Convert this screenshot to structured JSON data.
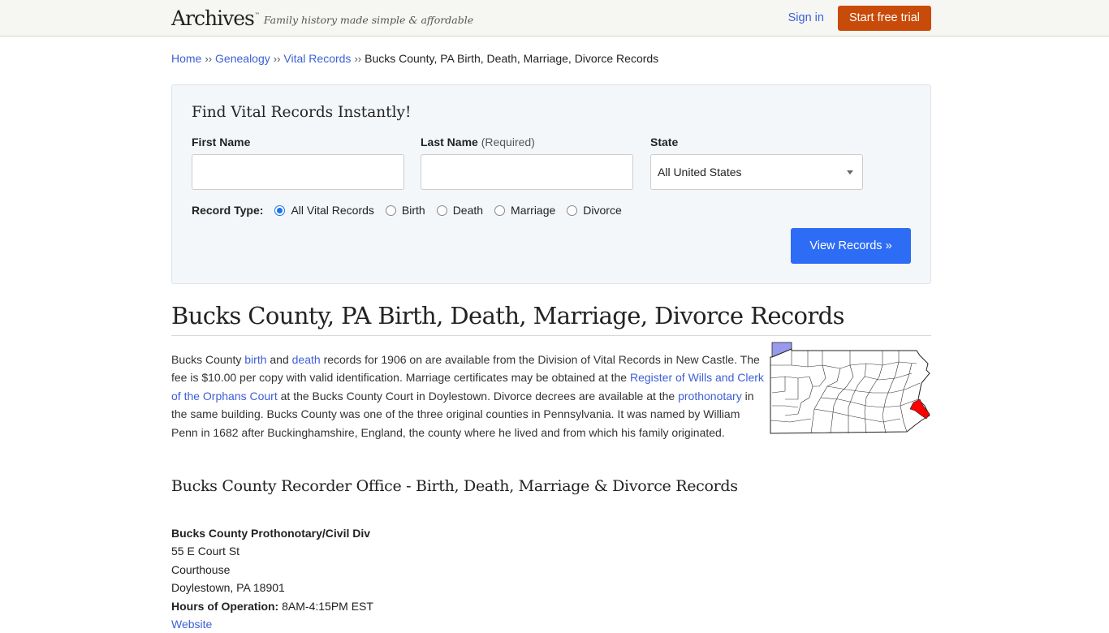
{
  "header": {
    "logo": "Archives",
    "logo_tm": "™",
    "tagline": "Family history made simple & affordable",
    "signin_label": "Sign in",
    "trial_label": "Start free trial",
    "colors": {
      "trial_bg": "#c94b09",
      "link": "#3d5fd6"
    }
  },
  "breadcrumb": {
    "items": [
      "Home",
      "Genealogy",
      "Vital Records"
    ],
    "separator": "››",
    "current": "Bucks County, PA Birth, Death, Marriage, Divorce Records"
  },
  "search": {
    "title": "Find Vital Records Instantly!",
    "first_name_label": "First Name",
    "first_name_value": "",
    "last_name_label": "Last Name",
    "last_name_hint": "(Required)",
    "last_name_value": "",
    "state_label": "State",
    "state_selected": "All United States",
    "record_type_label": "Record Type:",
    "record_types": [
      {
        "label": "All Vital Records",
        "checked": true
      },
      {
        "label": "Birth",
        "checked": false
      },
      {
        "label": "Death",
        "checked": false
      },
      {
        "label": "Marriage",
        "checked": false
      },
      {
        "label": "Divorce",
        "checked": false
      }
    ],
    "submit_label": "View Records »",
    "colors": {
      "submit_bg": "#2d6cf5",
      "radio": "#1a73e8"
    }
  },
  "main": {
    "title": "Bucks County, PA Birth, Death, Marriage, Divorce Records",
    "intro": {
      "t1": "Bucks County ",
      "link_birth": "birth",
      "t2": " and ",
      "link_death": "death",
      "t3": " records for 1906 on are available from the Division of Vital Records in New Castle. The fee is $10.00 per copy with valid identification. Marriage certificates may be obtained at the ",
      "link_register": "Register of Wills and Clerk of the Orphans Court",
      "t4": " at the Bucks County Court in Doylestown. Divorce decrees are available at the ",
      "link_prothonotary": "prothonotary",
      "t5": " in the same building. Bucks County was one of the three original counties in Pennsylvania. It was named by William Penn in 1682 after Buckinghamshire, England, the county where he lived and from which his family originated."
    },
    "map": {
      "highlight_color": "#ff0000",
      "lake_color": "#9999ee"
    },
    "subtitle": "Bucks County Recorder Office - Birth, Death, Marriage & Divorce Records",
    "office": {
      "name": "Bucks County Prothonotary/Civil Div",
      "address1": "55 E Court St",
      "address2": "Courthouse",
      "city": "Doylestown, PA 18901",
      "hours_label": "Hours of Operation:",
      "hours": " 8AM-4:15PM EST",
      "website_label": "Website"
    }
  }
}
